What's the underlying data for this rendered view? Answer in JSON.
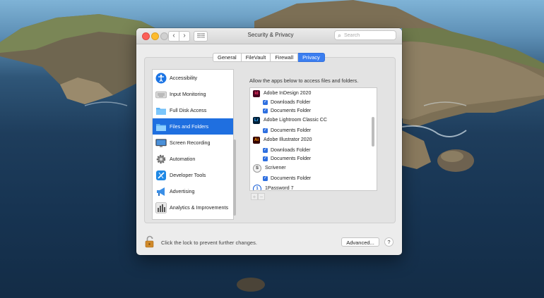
{
  "window": {
    "title": "Security & Privacy"
  },
  "toolbar": {
    "back_label": "‹",
    "forward_label": "›",
    "grid_label": "⠿⠿",
    "search_placeholder": "Search"
  },
  "tabs": [
    {
      "label": "General",
      "active": false
    },
    {
      "label": "FileVault",
      "active": false
    },
    {
      "label": "Firewall",
      "active": false
    },
    {
      "label": "Privacy",
      "active": true
    }
  ],
  "sidebar": {
    "items": [
      {
        "label": "Accessibility",
        "icon": "accessibility-icon"
      },
      {
        "label": "Input Monitoring",
        "icon": "keyboard-icon"
      },
      {
        "label": "Full Disk Access",
        "icon": "folder-icon"
      },
      {
        "label": "Files and Folders",
        "icon": "folder-icon",
        "selected": true
      },
      {
        "label": "Screen Recording",
        "icon": "display-icon"
      },
      {
        "label": "Automation",
        "icon": "gear-icon"
      },
      {
        "label": "Developer Tools",
        "icon": "developer-tools-icon"
      },
      {
        "label": "Advertising",
        "icon": "megaphone-icon"
      },
      {
        "label": "Analytics & Improvements",
        "icon": "analytics-icon"
      }
    ]
  },
  "main": {
    "description": "Allow the apps below to access files and folders.",
    "apps": [
      {
        "name": "Adobe InDesign 2020",
        "icon_text": "Id",
        "icon_color": "#49021f",
        "text_color": "#ff3366",
        "folders": [
          {
            "label": "Downloads Folder",
            "checked": true
          },
          {
            "label": "Documents Folder",
            "checked": true
          }
        ]
      },
      {
        "name": "Adobe Lightroom Classic CC",
        "icon_text": "Lr",
        "icon_color": "#001e36",
        "text_color": "#31a8ff",
        "folders": [
          {
            "label": "Documents Folder",
            "checked": true
          }
        ]
      },
      {
        "name": "Adobe Illustrator 2020",
        "icon_text": "Ai",
        "icon_color": "#330000",
        "text_color": "#ff9a00",
        "folders": [
          {
            "label": "Downloads Folder",
            "checked": true
          },
          {
            "label": "Documents Folder",
            "checked": true
          }
        ]
      },
      {
        "name": "Scrivener",
        "icon_text": "S",
        "icon_color": "#f2f2f2",
        "text_color": "#333333",
        "folders": [
          {
            "label": "Documents Folder",
            "checked": true
          }
        ]
      },
      {
        "name": "1Password 7",
        "icon_text": "1",
        "icon_color": "#ffffff",
        "text_color": "#1a5fd6",
        "folders": []
      }
    ],
    "add_label": "+",
    "remove_label": "−"
  },
  "footer": {
    "lock_text": "Click the lock to prevent further changes.",
    "advanced_label": "Advanced...",
    "help_label": "?"
  },
  "colors": {
    "accent": "#1f6fe0",
    "checkbox": "#2e6fe0"
  }
}
